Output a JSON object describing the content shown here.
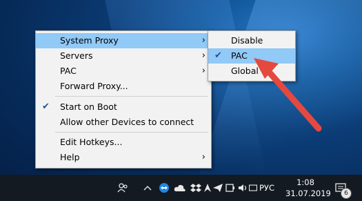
{
  "tray_menu": {
    "items": [
      {
        "label": "System Proxy",
        "submenu": true,
        "checked": false
      },
      {
        "label": "Servers",
        "submenu": true,
        "checked": false
      },
      {
        "label": "PAC",
        "submenu": true,
        "checked": false
      },
      {
        "label": "Forward Proxy...",
        "submenu": false,
        "checked": false
      },
      {
        "label": "Start on Boot",
        "submenu": false,
        "checked": true
      },
      {
        "label": "Allow other Devices to connect",
        "submenu": false,
        "checked": false
      },
      {
        "label": "Edit Hotkeys...",
        "submenu": false,
        "checked": false
      },
      {
        "label": "Help",
        "submenu": true,
        "checked": false
      }
    ]
  },
  "submenu": {
    "items": [
      {
        "label": "Disable",
        "checked": false
      },
      {
        "label": "PAC",
        "checked": true
      },
      {
        "label": "Global",
        "checked": false
      }
    ]
  },
  "taskbar": {
    "language": "РУС",
    "time": "1:08",
    "date": "31.07.2019",
    "notifications_count": "6",
    "icons": [
      "people-icon",
      "chevron-up-icon",
      "teamviewer-icon",
      "cloud-icon",
      "dropbox-icon",
      "shadowsocks-icon",
      "paper-plane-icon",
      "battery-icon",
      "volume-icon",
      "keyboard-icon",
      "notifications-icon"
    ]
  },
  "colors": {
    "highlight": "#91c9f7",
    "arrow": "#e5483f",
    "taskbar": "#141a22"
  }
}
